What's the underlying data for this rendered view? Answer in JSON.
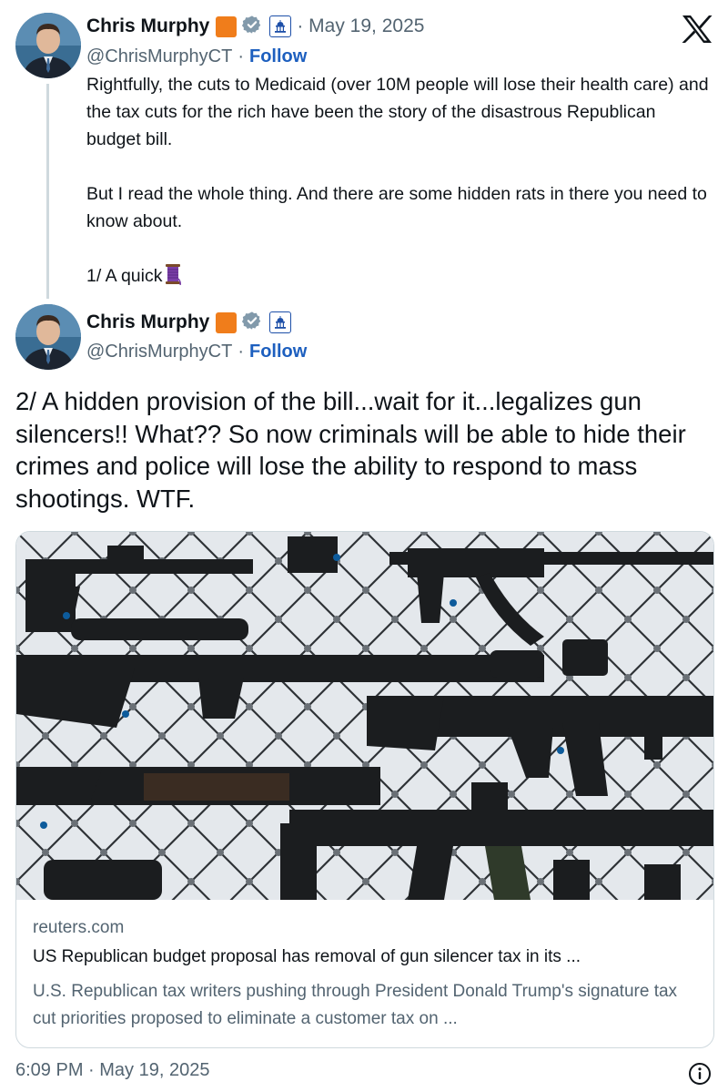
{
  "tweet1": {
    "display_name": "Chris Murphy",
    "handle": "@ChrisMurphyCT",
    "date": "· May 19, 2025",
    "follow_label": "Follow",
    "separator": "·",
    "paragraphs": [
      "Rightfully, the cuts to Medicaid (over 10M people will lose their health care) and the tax cuts for the rich have been the story of the disastrous Republican budget bill.",
      "But I read the whole thing. And there are some hidden rats in there you need to know about.",
      "1/ A quick"
    ]
  },
  "tweet2": {
    "display_name": "Chris Murphy",
    "handle": "@ChrisMurphyCT",
    "follow_label": "Follow",
    "separator": "·",
    "text": "2/ A hidden provision of the bill...wait for it...legalizes gun silencers!! What?? So now criminals will be able to hide their crimes and police will lose the ability to respond to mass shootings. WTF."
  },
  "card": {
    "domain": "reuters.com",
    "title": "US Republican budget proposal has removal of gun silencer tax in its ...",
    "description": "U.S. Republican tax writers pushing through President Donald Trump's signature tax cut priorities proposed to eliminate a customer tax on ..."
  },
  "footer": {
    "timestamp": "6:09 PM · May 19, 2025"
  },
  "icons": {
    "x_logo": "x-logo-icon",
    "info": "info-icon",
    "verified": "verified-badge-icon",
    "capitol": "capitol-icon",
    "spool": "thread-spool-icon"
  },
  "colors": {
    "follow": "#1d5fbf",
    "secondary_text": "#536471",
    "orange_badge": "#f07d1b",
    "verified_badge": "#829aab"
  }
}
